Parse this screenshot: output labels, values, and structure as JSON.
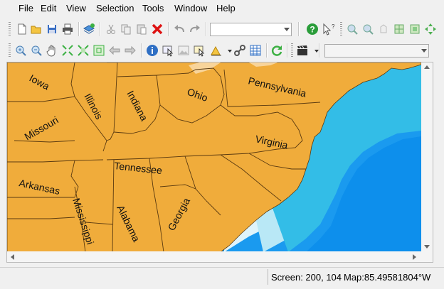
{
  "menu": {
    "file": "File",
    "edit": "Edit",
    "view": "View",
    "selection": "Selection",
    "tools": "Tools",
    "window": "Window",
    "help": "Help"
  },
  "toolbar1": {
    "icons": [
      "new-icon",
      "open-icon",
      "save-icon",
      "print-icon",
      "add-layer-icon",
      "cut-icon",
      "copy-icon",
      "paste-icon",
      "delete-icon",
      "undo-icon",
      "redo-icon",
      "help-icon",
      "whats-this-icon",
      "zoom-in-icon",
      "zoom-out-icon",
      "zoom-full-icon",
      "zoom-layer-icon",
      "zoom-selection-icon",
      "zoom-fit-icon"
    ],
    "combo_value": ""
  },
  "toolbar2": {
    "icons": [
      "zoom-in-icon",
      "zoom-out-icon",
      "pan-icon",
      "zoom-extent-icon",
      "full-extent-icon",
      "zoom-box-icon",
      "back-icon",
      "forward-icon",
      "identify-icon",
      "select-icon",
      "image-icon",
      "select-rect-icon",
      "draw-icon",
      "link-icon",
      "table-icon",
      "refresh-icon",
      "clapper-icon"
    ],
    "combo_value": ""
  },
  "map": {
    "labels": [
      "Iowa",
      "Illinois",
      "Indiana",
      "Ohio",
      "Pennsylvania",
      "Missouri",
      "Virginia",
      "Tennessee",
      "Arkansas",
      "Mississippi",
      "Alabama",
      "Georgia"
    ],
    "colors": {
      "land": "#f0ac3b",
      "border": "#5a3a10",
      "shallow": "#dff4fb",
      "mid": "#b9e8f6",
      "teal": "#33bde7",
      "deep": "#0d8fec",
      "ocean": "#1a9aef"
    }
  },
  "status": {
    "screen": "Screen: 200, 104",
    "map": "Map:85.49581804°W"
  }
}
